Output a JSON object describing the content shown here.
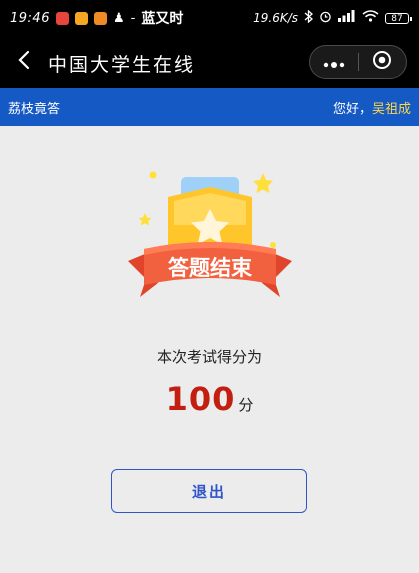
{
  "status_bar": {
    "time": "19:46",
    "carrier": "蓝又时",
    "net_speed": "19.6K/s",
    "battery": "87"
  },
  "title_bar": {
    "title": "中国大学生在线"
  },
  "app_header": {
    "left_label": "荔枝竟答",
    "greeting": "您好，",
    "user_name": "吴祖成"
  },
  "result": {
    "badge_text": "答题结束",
    "score_label": "本次考试得分为",
    "score": "100",
    "score_unit": "分"
  },
  "actions": {
    "exit_label": "退出"
  },
  "colors": {
    "header_blue": "#1559c4",
    "score_red": "#c21f10",
    "button_blue": "#2f55c9",
    "name_yellow": "#ffd84a"
  }
}
